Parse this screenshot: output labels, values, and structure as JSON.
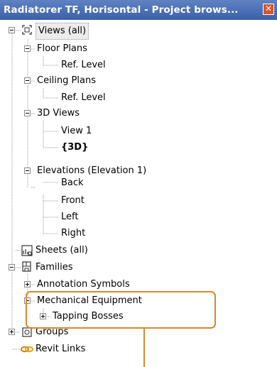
{
  "window": {
    "title": "Radiatorer TF, Horisontal - Project brows...",
    "close_glyph": "✕"
  },
  "tree": {
    "views_all": "Views (all)",
    "floor_plans": "Floor Plans",
    "floor_plans_ref": "Ref. Level",
    "ceiling_plans": "Ceiling Plans",
    "ceiling_plans_ref": "Ref. Level",
    "views_3d": "3D Views",
    "view1": "View 1",
    "view_3d": "{3D}",
    "elevations": "Elevations (Elevation 1)",
    "back": "Back",
    "front": "Front",
    "left": "Left",
    "right": "Right",
    "sheets": "Sheets (all)",
    "families": "Families",
    "annotation_symbols": "Annotation Symbols",
    "mechanical_equipment": "Mechanical Equipment",
    "tapping_bosses": "Tapping Bosses",
    "groups": "Groups",
    "revit_links": "Revit Links"
  },
  "colors": {
    "titlebar": "#4a6fb5",
    "highlight": "#d98a2b",
    "close_button": "#d9532b"
  }
}
